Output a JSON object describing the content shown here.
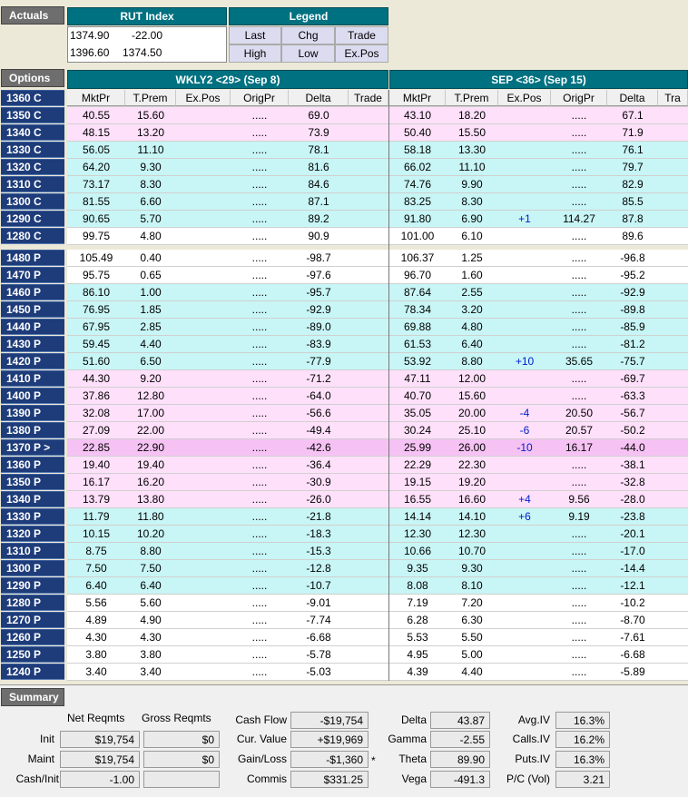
{
  "sections": {
    "actuals": "Actuals",
    "options": "Options",
    "summary": "Summary"
  },
  "actuals": {
    "index_title": "RUT Index",
    "legend_title": "Legend",
    "values": [
      [
        "1374.90",
        "-22.00"
      ],
      [
        "1396.60",
        "1374.50"
      ]
    ],
    "legend": [
      [
        "Last",
        "Chg",
        "Trade"
      ],
      [
        "High",
        "Low",
        "Ex.Pos"
      ]
    ]
  },
  "expiries": [
    "WKLY2 <29> (Sep 8)",
    "SEP <36> (Sep 15)"
  ],
  "columns": [
    "MktPr",
    "T.Prem",
    "Ex.Pos",
    "OrigPr",
    "Delta",
    "Trade"
  ],
  "columns2": [
    "MktPr",
    "T.Prem",
    "Ex.Pos",
    "OrigPr",
    "Delta",
    "Tra"
  ],
  "header_label": "1360 C",
  "rows": [
    {
      "label": "1350 C",
      "bg": "pink",
      "w": [
        "40.55",
        "15.60",
        "",
        ".....",
        "69.0"
      ],
      "s": [
        "43.10",
        "18.20",
        "",
        ".....",
        "67.1"
      ]
    },
    {
      "label": "1340 C",
      "bg": "pink",
      "w": [
        "48.15",
        "13.20",
        "",
        ".....",
        "73.9"
      ],
      "s": [
        "50.40",
        "15.50",
        "",
        ".....",
        "71.9"
      ]
    },
    {
      "label": "1330 C",
      "bg": "cyan",
      "w": [
        "56.05",
        "11.10",
        "",
        ".....",
        "78.1"
      ],
      "s": [
        "58.18",
        "13.30",
        "",
        ".....",
        "76.1"
      ]
    },
    {
      "label": "1320 C",
      "bg": "cyan",
      "w": [
        "64.20",
        "9.30",
        "",
        ".....",
        "81.6"
      ],
      "s": [
        "66.02",
        "11.10",
        "",
        ".....",
        "79.7"
      ]
    },
    {
      "label": "1310 C",
      "bg": "cyan",
      "w": [
        "73.17",
        "8.30",
        "",
        ".....",
        "84.6"
      ],
      "s": [
        "74.76",
        "9.90",
        "",
        ".....",
        "82.9"
      ]
    },
    {
      "label": "1300 C",
      "bg": "cyan",
      "w": [
        "81.55",
        "6.60",
        "",
        ".....",
        "87.1"
      ],
      "s": [
        "83.25",
        "8.30",
        "",
        ".....",
        "85.5"
      ]
    },
    {
      "label": "1290 C",
      "bg": "cyan",
      "w": [
        "90.65",
        "5.70",
        "",
        ".....",
        "89.2"
      ],
      "s": [
        "91.80",
        "6.90",
        "+1",
        "114.27",
        "87.8"
      ]
    },
    {
      "label": "1280 C",
      "bg": "white",
      "w": [
        "99.75",
        "4.80",
        "",
        ".....",
        "90.9"
      ],
      "s": [
        "101.00",
        "6.10",
        "",
        ".....",
        "89.6"
      ]
    },
    {
      "label": "1480 P",
      "bg": "white",
      "w": [
        "105.49",
        "0.40",
        "",
        ".....",
        "-98.7"
      ],
      "s": [
        "106.37",
        "1.25",
        "",
        ".....",
        "-96.8"
      ]
    },
    {
      "label": "1470 P",
      "bg": "white",
      "w": [
        "95.75",
        "0.65",
        "",
        ".....",
        "-97.6"
      ],
      "s": [
        "96.70",
        "1.60",
        "",
        ".....",
        "-95.2"
      ]
    },
    {
      "label": "1460 P",
      "bg": "cyan",
      "w": [
        "86.10",
        "1.00",
        "",
        ".....",
        "-95.7"
      ],
      "s": [
        "87.64",
        "2.55",
        "",
        ".....",
        "-92.9"
      ]
    },
    {
      "label": "1450 P",
      "bg": "cyan",
      "w": [
        "76.95",
        "1.85",
        "",
        ".....",
        "-92.9"
      ],
      "s": [
        "78.34",
        "3.20",
        "",
        ".....",
        "-89.8"
      ]
    },
    {
      "label": "1440 P",
      "bg": "cyan",
      "w": [
        "67.95",
        "2.85",
        "",
        ".....",
        "-89.0"
      ],
      "s": [
        "69.88",
        "4.80",
        "",
        ".....",
        "-85.9"
      ]
    },
    {
      "label": "1430 P",
      "bg": "cyan",
      "w": [
        "59.45",
        "4.40",
        "",
        ".....",
        "-83.9"
      ],
      "s": [
        "61.53",
        "6.40",
        "",
        ".....",
        "-81.2"
      ]
    },
    {
      "label": "1420 P",
      "bg": "cyan",
      "w": [
        "51.60",
        "6.50",
        "",
        ".....",
        "-77.9"
      ],
      "s": [
        "53.92",
        "8.80",
        "+10",
        "35.65",
        "-75.7"
      ]
    },
    {
      "label": "1410 P",
      "bg": "pink",
      "w": [
        "44.30",
        "9.20",
        "",
        ".....",
        "-71.2"
      ],
      "s": [
        "47.11",
        "12.00",
        "",
        ".....",
        "-69.7"
      ]
    },
    {
      "label": "1400 P",
      "bg": "pink",
      "w": [
        "37.86",
        "12.80",
        "",
        ".....",
        "-64.0"
      ],
      "s": [
        "40.70",
        "15.60",
        "",
        ".....",
        "-63.3"
      ]
    },
    {
      "label": "1390 P",
      "bg": "pink",
      "w": [
        "32.08",
        "17.00",
        "",
        ".....",
        "-56.6"
      ],
      "s": [
        "35.05",
        "20.00",
        "-4",
        "20.50",
        "-56.7"
      ]
    },
    {
      "label": "1380 P",
      "bg": "pink",
      "w": [
        "27.09",
        "22.00",
        "",
        ".....",
        "-49.4"
      ],
      "s": [
        "30.24",
        "25.10",
        "-6",
        "20.57",
        "-50.2"
      ]
    },
    {
      "label": "1370 P >",
      "bg": "mag",
      "w": [
        "22.85",
        "22.90",
        "",
        ".....",
        "-42.6"
      ],
      "s": [
        "25.99",
        "26.00",
        "-10",
        "16.17",
        "-44.0"
      ]
    },
    {
      "label": "1360 P",
      "bg": "pink",
      "w": [
        "19.40",
        "19.40",
        "",
        ".....",
        "-36.4"
      ],
      "s": [
        "22.29",
        "22.30",
        "",
        ".....",
        "-38.1"
      ]
    },
    {
      "label": "1350 P",
      "bg": "pink",
      "w": [
        "16.17",
        "16.20",
        "",
        ".....",
        "-30.9"
      ],
      "s": [
        "19.15",
        "19.20",
        "",
        ".....",
        "-32.8"
      ]
    },
    {
      "label": "1340 P",
      "bg": "pink",
      "w": [
        "13.79",
        "13.80",
        "",
        ".....",
        "-26.0"
      ],
      "s": [
        "16.55",
        "16.60",
        "+4",
        "9.56",
        "-28.0"
      ]
    },
    {
      "label": "1330 P",
      "bg": "cyan",
      "w": [
        "11.79",
        "11.80",
        "",
        ".....",
        "-21.8"
      ],
      "s": [
        "14.14",
        "14.10",
        "+6",
        "9.19",
        "-23.8"
      ]
    },
    {
      "label": "1320 P",
      "bg": "cyan",
      "w": [
        "10.15",
        "10.20",
        "",
        ".....",
        "-18.3"
      ],
      "s": [
        "12.30",
        "12.30",
        "",
        ".....",
        "-20.1"
      ]
    },
    {
      "label": "1310 P",
      "bg": "cyan",
      "w": [
        "8.75",
        "8.80",
        "",
        ".....",
        "-15.3"
      ],
      "s": [
        "10.66",
        "10.70",
        "",
        ".....",
        "-17.0"
      ]
    },
    {
      "label": "1300 P",
      "bg": "cyan",
      "w": [
        "7.50",
        "7.50",
        "",
        ".....",
        "-12.8"
      ],
      "s": [
        "9.35",
        "9.30",
        "",
        ".....",
        "-14.4"
      ]
    },
    {
      "label": "1290 P",
      "bg": "cyan",
      "w": [
        "6.40",
        "6.40",
        "",
        ".....",
        "-10.7"
      ],
      "s": [
        "8.08",
        "8.10",
        "",
        ".....",
        "-12.1"
      ]
    },
    {
      "label": "1280 P",
      "bg": "white",
      "w": [
        "5.56",
        "5.60",
        "",
        ".....",
        "-9.01"
      ],
      "s": [
        "7.19",
        "7.20",
        "",
        ".....",
        "-10.2"
      ]
    },
    {
      "label": "1270 P",
      "bg": "white",
      "w": [
        "4.89",
        "4.90",
        "",
        ".....",
        "-7.74"
      ],
      "s": [
        "6.28",
        "6.30",
        "",
        ".....",
        "-8.70"
      ]
    },
    {
      "label": "1260 P",
      "bg": "white",
      "w": [
        "4.30",
        "4.30",
        "",
        ".....",
        "-6.68"
      ],
      "s": [
        "5.53",
        "5.50",
        "",
        ".....",
        "-7.61"
      ]
    },
    {
      "label": "1250 P",
      "bg": "white",
      "w": [
        "3.80",
        "3.80",
        "",
        ".....",
        "-5.78"
      ],
      "s": [
        "4.95",
        "5.00",
        "",
        ".....",
        "-6.68"
      ]
    },
    {
      "label": "1240 P",
      "bg": "white",
      "w": [
        "3.40",
        "3.40",
        "",
        ".....",
        "-5.03"
      ],
      "s": [
        "4.39",
        "4.40",
        "",
        ".....",
        "-5.89"
      ]
    }
  ],
  "summary": {
    "net_reqmts": "Net Reqmts",
    "gross_reqmts": "Gross Reqmts",
    "row_labels": [
      "Init",
      "Maint",
      "Cash/Init"
    ],
    "net": [
      "$19,754",
      "$19,754",
      "-1.00"
    ],
    "gross": [
      "$0",
      "$0",
      ""
    ],
    "mid_labels": [
      "Cash Flow",
      "Cur. Value",
      "Gain/Loss",
      "Commis"
    ],
    "mid_values": [
      "-$19,754",
      "+$19,969",
      "-$1,360",
      "$331.25"
    ],
    "gain_marker": "*",
    "greek_labels": [
      "Delta",
      "Gamma",
      "Theta",
      "Vega"
    ],
    "greek_values": [
      "43.87",
      "-2.55",
      "89.90",
      "-491.3"
    ],
    "iv_labels": [
      "Avg.IV",
      "Calls.IV",
      "Puts.IV",
      "P/C (Vol)"
    ],
    "iv_values": [
      "16.3%",
      "16.2%",
      "16.3%",
      "3.21"
    ]
  }
}
